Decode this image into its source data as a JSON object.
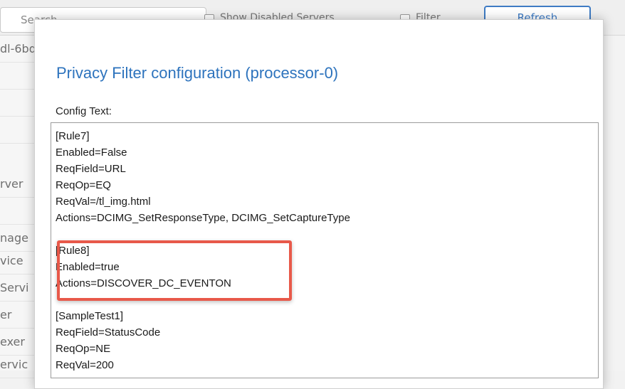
{
  "background": {
    "search": {
      "placeholder": "Search"
    },
    "checkbox1": {
      "label": "Show Disabled Servers"
    },
    "checkbox2": {
      "label": "Filter"
    },
    "refresh_label": "Refresh",
    "list_rows": [
      "dl-6bd",
      "",
      "",
      "",
      "rver",
      "",
      "nage",
      "vice",
      "Servi",
      "er",
      "exer",
      "ervic"
    ]
  },
  "modal": {
    "title": "Privacy Filter configuration (processor-0)",
    "config_label": "Config Text:",
    "config_lines": [
      "[Rule7]",
      "Enabled=False",
      "ReqField=URL",
      "ReqOp=EQ",
      "ReqVal=/tl_img.html",
      "Actions=DCIMG_SetResponseType, DCIMG_SetCaptureType",
      "",
      "[Rule8]",
      "Enabled=true",
      "Actions=DISCOVER_DC_EVENTON",
      "",
      "[SampleTest1]",
      "ReqField=StatusCode",
      "ReqOp=NE",
      "ReqVal=200"
    ]
  },
  "colors": {
    "title": "#2d73bd",
    "highlight": "#e8594a",
    "refresh_border": "#3e7bc4"
  }
}
